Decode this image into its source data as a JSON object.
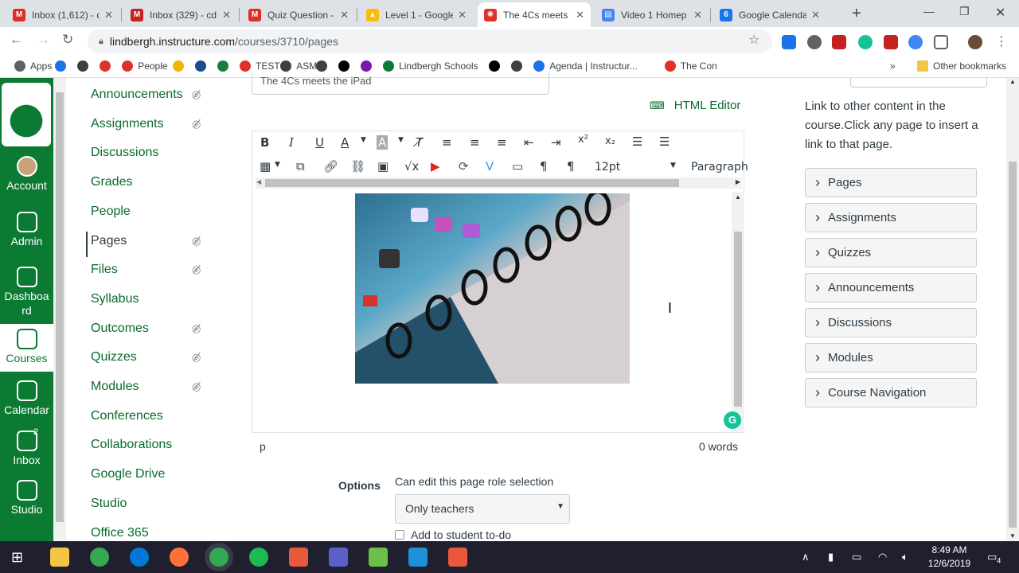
{
  "browser": {
    "tabs": [
      {
        "title": "Inbox (1,612) - cd",
        "icon_color": "#d93025",
        "icon_name": "gmail-icon",
        "icon_glyph": "M"
      },
      {
        "title": "Inbox (329) - cd",
        "icon_color": "#c5221f",
        "icon_name": "gmail-icon",
        "icon_glyph": "M"
      },
      {
        "title": "Quiz Question -",
        "icon_color": "#d93025",
        "icon_name": "gmail-icon",
        "icon_glyph": "M"
      },
      {
        "title": "Level 1 - Google",
        "icon_color": "#fbbc04",
        "icon_name": "drive-icon",
        "icon_glyph": "▲"
      },
      {
        "title": "The 4Cs meets t",
        "icon_color": "#e0302a",
        "icon_name": "canvas-icon",
        "icon_glyph": "✺"
      },
      {
        "title": "Video 1 Homep",
        "icon_color": "#4285f4",
        "icon_name": "docs-icon",
        "icon_glyph": "▤"
      },
      {
        "title": "Google Calenda",
        "icon_color": "#1a73e8",
        "icon_name": "calendar-icon",
        "icon_glyph": "6"
      }
    ],
    "active_tab": 4,
    "url_host": "lindbergh.instructure.com",
    "url_path": "/courses/3710/pages",
    "bookmarks": [
      {
        "label": "Apps",
        "color": "#5f6368"
      },
      {
        "label": "",
        "color": "#1a73e8"
      },
      {
        "label": "",
        "color": "#3c4043"
      },
      {
        "label": "",
        "color": "#e0302a"
      },
      {
        "label": "People",
        "color": "#e0302a"
      },
      {
        "label": "",
        "color": "#f4b400"
      },
      {
        "label": "",
        "color": "#1a4d8f"
      },
      {
        "label": "",
        "color": "#188038"
      },
      {
        "label": "TEST",
        "color": "#e0302a"
      },
      {
        "label": "ASM",
        "color": "#3c4043"
      },
      {
        "label": "",
        "color": "#3c4043"
      },
      {
        "label": "",
        "color": "#000000"
      },
      {
        "label": "",
        "color": "#7719aa"
      },
      {
        "label": "Lindbergh Schools",
        "color": "#0b7a33"
      },
      {
        "label": "",
        "color": "#000000"
      },
      {
        "label": "",
        "color": "#3c4043"
      },
      {
        "label": "Agenda | Instructur...",
        "color": "#1a73e8"
      },
      {
        "label": "The Con",
        "color": "#e0302a"
      }
    ],
    "other_bookmarks": "Other bookmarks"
  },
  "global_nav": [
    {
      "label": "Account",
      "icon": "avatar-icon"
    },
    {
      "label": "Admin",
      "icon": "shield-icon"
    },
    {
      "label": "Dashboa\nrd",
      "icon": "dashboard-icon"
    },
    {
      "label": "Courses",
      "icon": "courses-icon"
    },
    {
      "label": "Calendar",
      "icon": "calendar-icon"
    },
    {
      "label": "Inbox",
      "icon": "inbox-icon",
      "badge": "2"
    },
    {
      "label": "Studio",
      "icon": "studio-icon"
    }
  ],
  "course_nav": [
    {
      "label": "Announcements",
      "hidden": true
    },
    {
      "label": "Assignments",
      "hidden": true
    },
    {
      "label": "Discussions",
      "hidden": false
    },
    {
      "label": "Grades",
      "hidden": false
    },
    {
      "label": "People",
      "hidden": false
    },
    {
      "label": "Pages",
      "hidden": true,
      "active": true
    },
    {
      "label": "Files",
      "hidden": true
    },
    {
      "label": "Syllabus",
      "hidden": false
    },
    {
      "label": "Outcomes",
      "hidden": true
    },
    {
      "label": "Quizzes",
      "hidden": true
    },
    {
      "label": "Modules",
      "hidden": true
    },
    {
      "label": "Conferences",
      "hidden": false
    },
    {
      "label": "Collaborations",
      "hidden": false
    },
    {
      "label": "Google Drive",
      "hidden": false
    },
    {
      "label": "Studio",
      "hidden": false
    },
    {
      "label": "Office 365",
      "hidden": false
    }
  ],
  "editor": {
    "title_value": "The 4Cs meets the iPad",
    "html_editor_label": "HTML Editor",
    "font_size": "12pt",
    "block_format": "Paragraph",
    "path": "p",
    "word_count": "0 words"
  },
  "options": {
    "label": "Options",
    "role_label": "Can edit this page role selection",
    "role_value": "Only teachers",
    "todo_label": "Add to student to-do"
  },
  "sidebar": {
    "description": "Link to other content in the course.Click any page to insert a link to that page.",
    "sections": [
      "Pages",
      "Assignments",
      "Quizzes",
      "Announcements",
      "Discussions",
      "Modules",
      "Course Navigation"
    ]
  },
  "taskbar": {
    "time": "8:49 AM",
    "date": "12/6/2019",
    "notifications": "4"
  }
}
